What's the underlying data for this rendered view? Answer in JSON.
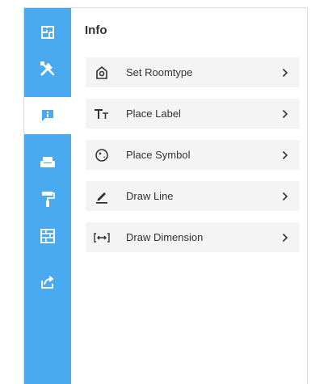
{
  "sidebar": {
    "items": [
      {
        "icon": "floor-plan-icon",
        "active": false
      },
      {
        "icon": "tools-icon",
        "active": false
      },
      {
        "icon": "info-icon",
        "active": true
      },
      {
        "icon": "sofa-icon",
        "active": false
      },
      {
        "icon": "paint-roller-icon",
        "active": false
      },
      {
        "icon": "wall-icon",
        "active": false
      },
      {
        "icon": "share-icon",
        "active": false
      }
    ]
  },
  "panel": {
    "title": "Info",
    "items": [
      {
        "label": "Set Roomtype",
        "icon": "room-type-icon"
      },
      {
        "label": "Place Label",
        "icon": "text-icon"
      },
      {
        "label": "Place Symbol",
        "icon": "symbol-icon"
      },
      {
        "label": "Draw Line",
        "icon": "pen-line-icon"
      },
      {
        "label": "Draw Dimension",
        "icon": "dimension-icon"
      }
    ]
  },
  "colors": {
    "rail": "#49aaf0",
    "rail_icon": "#ffffff",
    "active_icon": "#49aaf0",
    "row_background": "#f4f4f4",
    "text": "#333333"
  }
}
